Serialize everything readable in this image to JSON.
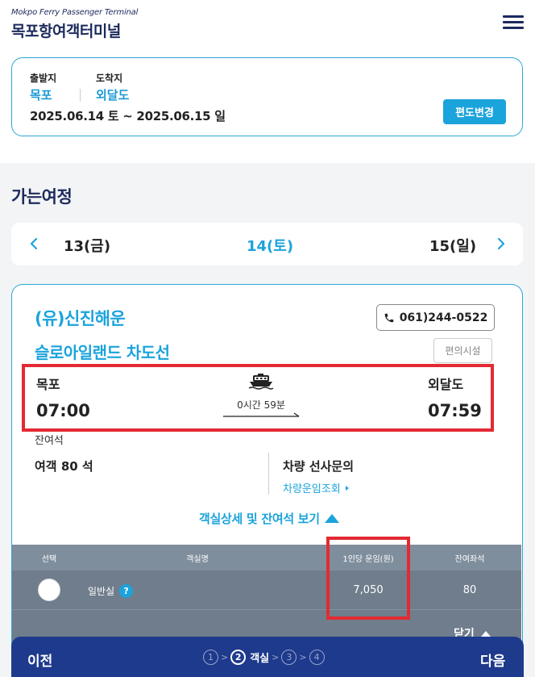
{
  "header": {
    "brand_en": "Mokpo Ferry Passenger Terminal",
    "brand_ko": "목포항여객터미널",
    "menu_icon": "hamburger-menu-icon"
  },
  "route": {
    "departure_label": "출발지",
    "departure_value": "목포",
    "arrival_label": "도착지",
    "arrival_value": "외달도",
    "dates": "2025.06.14 토 ~ 2025.06.15 일",
    "change_button": "편도변경"
  },
  "section_title": "가는여정",
  "date_nav": {
    "prev": "13(금)",
    "current": "14(토)",
    "next": "15(일)"
  },
  "schedule": {
    "operator": "(유)신진해운",
    "ship_name": "슬로아일랜드 차도선",
    "phone": "061)244-0522",
    "facility_button": "편의시설",
    "departure_port": "목포",
    "departure_time": "07:00",
    "arrival_port": "외달도",
    "arrival_time": "07:59",
    "duration": "0시간 59분",
    "remaining_label": "잔여석",
    "passenger_seats": "여객 80 석",
    "vehicle_title": "차량 선사문의",
    "vehicle_link": "차량운임조회",
    "toggle_detail": "객실상세 및 잔여석 보기"
  },
  "table": {
    "headers": {
      "select": "선택",
      "room": "객실명",
      "fare": "1인당 운임(원)",
      "seats": "잔여좌석"
    },
    "rows": [
      {
        "room": "일반실",
        "fare": "7,050",
        "seats": "80"
      }
    ],
    "help_icon": "?",
    "close_label": "닫기"
  },
  "bottom_nav": {
    "prev": "이전",
    "next": "다음",
    "steps": [
      "①",
      "②",
      "③",
      "④"
    ],
    "active_step_label": "객실"
  },
  "colors": {
    "brand_navy": "#1c2a5c",
    "accent_blue": "#1ba3dc",
    "highlight_red": "#e32a33",
    "bottom_bar": "#1e3a8c"
  }
}
